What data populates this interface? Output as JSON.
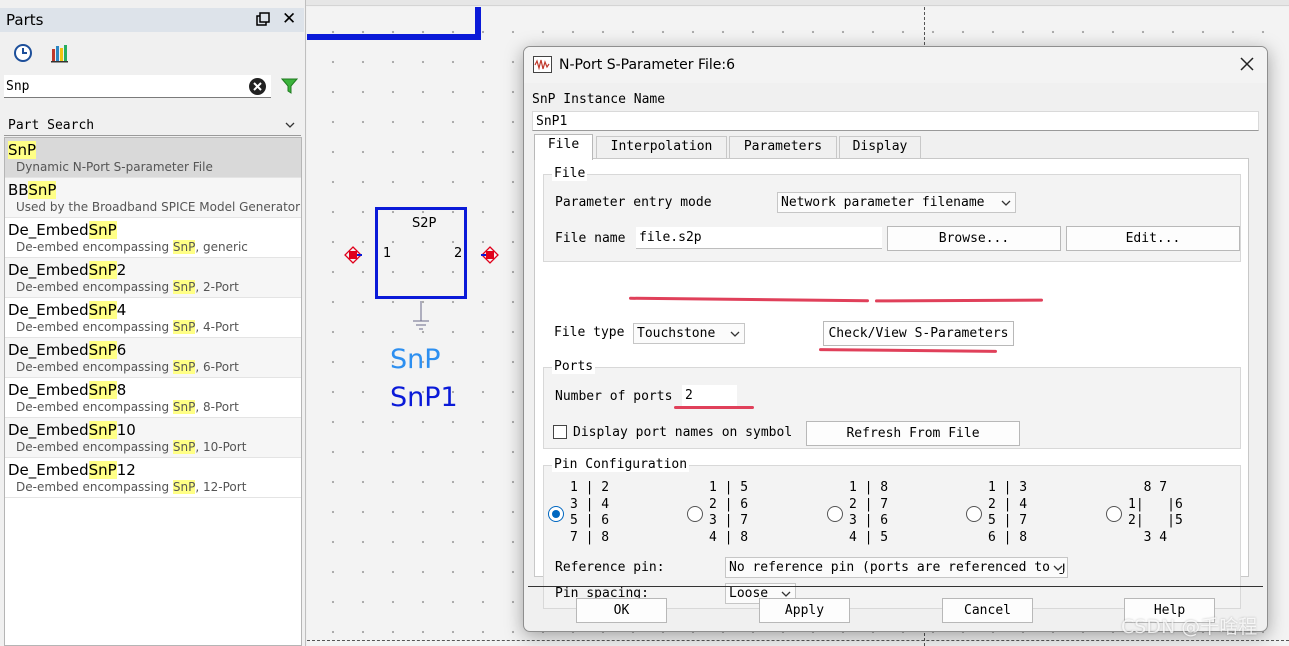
{
  "parts_panel": {
    "title": "Parts",
    "search": {
      "value": "Snp"
    },
    "search_mode": "Part Search",
    "items": [
      {
        "pre": "",
        "match": "SnP",
        "post": "",
        "desc_pre": "Dynamic N-Port S-parameter File",
        "desc_match": "",
        "desc_post": ""
      },
      {
        "pre": "BB",
        "match": "SnP",
        "post": "",
        "desc_pre": "Used by the Broadband SPICE Model Generator",
        "desc_match": "",
        "desc_post": ""
      },
      {
        "pre": "De_Embed",
        "match": "SnP",
        "post": "",
        "desc_pre": "De-embed encompassing ",
        "desc_match": "SnP",
        "desc_post": ", generic"
      },
      {
        "pre": "De_Embed",
        "match": "SnP",
        "post": "2",
        "desc_pre": "De-embed encompassing ",
        "desc_match": "SnP",
        "desc_post": ", 2-Port"
      },
      {
        "pre": "De_Embed",
        "match": "SnP",
        "post": "4",
        "desc_pre": "De-embed encompassing ",
        "desc_match": "SnP",
        "desc_post": ", 4-Port"
      },
      {
        "pre": "De_Embed",
        "match": "SnP",
        "post": "6",
        "desc_pre": "De-embed encompassing ",
        "desc_match": "SnP",
        "desc_post": ", 6-Port"
      },
      {
        "pre": "De_Embed",
        "match": "SnP",
        "post": "8",
        "desc_pre": "De-embed encompassing ",
        "desc_match": "SnP",
        "desc_post": ", 8-Port"
      },
      {
        "pre": "De_Embed",
        "match": "SnP",
        "post": "10",
        "desc_pre": "De-embed encompassing ",
        "desc_match": "SnP",
        "desc_post": ", 10-Port"
      },
      {
        "pre": "De_Embed",
        "match": "SnP",
        "post": "12",
        "desc_pre": "De-embed encompassing ",
        "desc_match": "SnP",
        "desc_post": ", 12-Port"
      }
    ],
    "selected_index": 0
  },
  "schematic": {
    "component_type": "S2P",
    "pin1": "1",
    "pin2": "2",
    "component_name": "SnP",
    "instance_name": "SnP1"
  },
  "dialog": {
    "title": "N-Port S-Parameter File:6",
    "instance_label": "SnP Instance Name",
    "instance_value": "SnP1",
    "tabs": [
      "File",
      "Interpolation",
      "Parameters",
      "Display"
    ],
    "active_tab": "File",
    "file_group": {
      "title": "File",
      "entry_mode_label": "Parameter entry mode",
      "entry_mode_value": "Network parameter filename",
      "file_name_label": "File name",
      "file_name_value": "file.s2p",
      "browse_label": "Browse...",
      "edit_label": "Edit..."
    },
    "file_type_label": "File type",
    "file_type_value": "Touchstone",
    "check_view_label": "Check/View S-Parameters",
    "ports_group": {
      "title": "Ports",
      "num_ports_label": "Number of ports",
      "num_ports_value": "2",
      "display_names_label": "Display port names on symbol",
      "display_names_checked": false,
      "refresh_label": "Refresh From File"
    },
    "pin_config": {
      "title": "Pin Configuration",
      "options": [
        {
          "text": "1 | 2\n3 | 4\n5 | 6\n7 | 8",
          "selected": true
        },
        {
          "text": "1 | 5\n2 | 6\n3 | 7\n4 | 8",
          "selected": false
        },
        {
          "text": "1 | 8\n2 | 7\n3 | 6\n4 | 5",
          "selected": false
        },
        {
          "text": "1 | 3\n2 | 4\n5 | 7\n6 | 8",
          "selected": false
        },
        {
          "text": "  8 7\n1|   |6\n2|   |5\n  3 4",
          "selected": false
        }
      ],
      "reference_pin_label": "Reference pin:",
      "reference_pin_value": "No reference pin (ports are referenced to ground)",
      "pin_spacing_label": "Pin spacing:",
      "pin_spacing_value": "Loose"
    },
    "buttons": {
      "ok": "OK",
      "apply": "Apply",
      "cancel": "Cancel",
      "help": "Help"
    }
  },
  "watermark": "CSDN @千啥程",
  "colors": {
    "wire_blue": "#0a1ad8",
    "component_name_blue": "#2d8ff0",
    "port_red": "#e0001b",
    "highlight_yellow": "#ffff86",
    "annotation_red": "#e0405a",
    "radio_selected": "#0067c0"
  },
  "icons": [
    "dock-icon",
    "close-icon",
    "history-icon",
    "library-icon",
    "clear-icon",
    "filter-icon",
    "chevron-down-icon",
    "app-icon",
    "ground-icon",
    "port-icon"
  ]
}
